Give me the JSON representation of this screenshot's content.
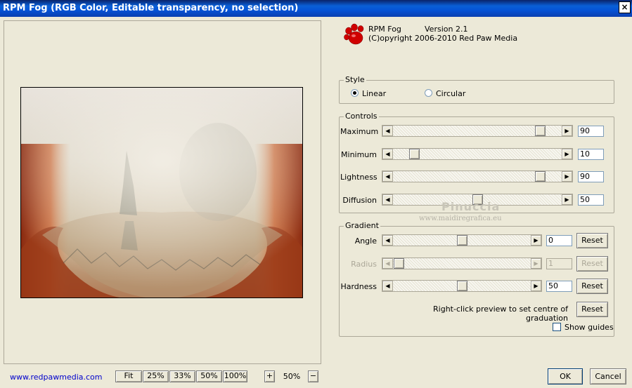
{
  "window": {
    "title": "RPM Fog (RGB Color, Editable transparency, no selection)",
    "close_glyph": "×"
  },
  "about": {
    "name": "RPM Fog",
    "version": "Version 2.1",
    "copyright": "(C)opyright 2006-2010 Red Paw Media",
    "logo_icon": "red-paw-icon"
  },
  "style": {
    "legend": "Style",
    "options": [
      {
        "label": "Linear",
        "selected": true
      },
      {
        "label": "Circular",
        "selected": false
      }
    ]
  },
  "controls": {
    "legend": "Controls",
    "rows": [
      {
        "label": "Maximum",
        "value": "90",
        "fraction": 0.9
      },
      {
        "label": "Minimum",
        "value": "10",
        "fraction": 0.1
      },
      {
        "label": "Lightness",
        "value": "90",
        "fraction": 0.9
      },
      {
        "label": "Diffusion",
        "value": "50",
        "fraction": 0.5
      }
    ]
  },
  "gradient": {
    "legend": "Gradient",
    "rows": [
      {
        "label": "Angle",
        "value": "0",
        "fraction": 0.5,
        "enabled": true,
        "reset": "Reset"
      },
      {
        "label": "Radius",
        "value": "1",
        "fraction": 0.0,
        "enabled": false,
        "reset": "Reset"
      },
      {
        "label": "Hardness",
        "value": "50",
        "fraction": 0.5,
        "enabled": true,
        "reset": "Reset"
      }
    ],
    "hint": "Right-click preview to set centre of graduation",
    "hint_reset": "Reset",
    "show_guides": "Show guides",
    "show_guides_checked": false
  },
  "watermark": {
    "name": "Pinuccia",
    "site": "www.maidiregrafica.eu"
  },
  "footer": {
    "link": "www.redpawmedia.com",
    "zoom_buttons": [
      "Fit",
      "25%",
      "33%",
      "50%",
      "100%"
    ],
    "zoom_plus": "+",
    "zoom_minus": "−",
    "zoom_value": "50%",
    "ok": "OK",
    "cancel": "Cancel"
  },
  "colors": {
    "title_bar": "#0a5fd6",
    "face": "#ece9d8",
    "accent_red": "#cc0000"
  }
}
